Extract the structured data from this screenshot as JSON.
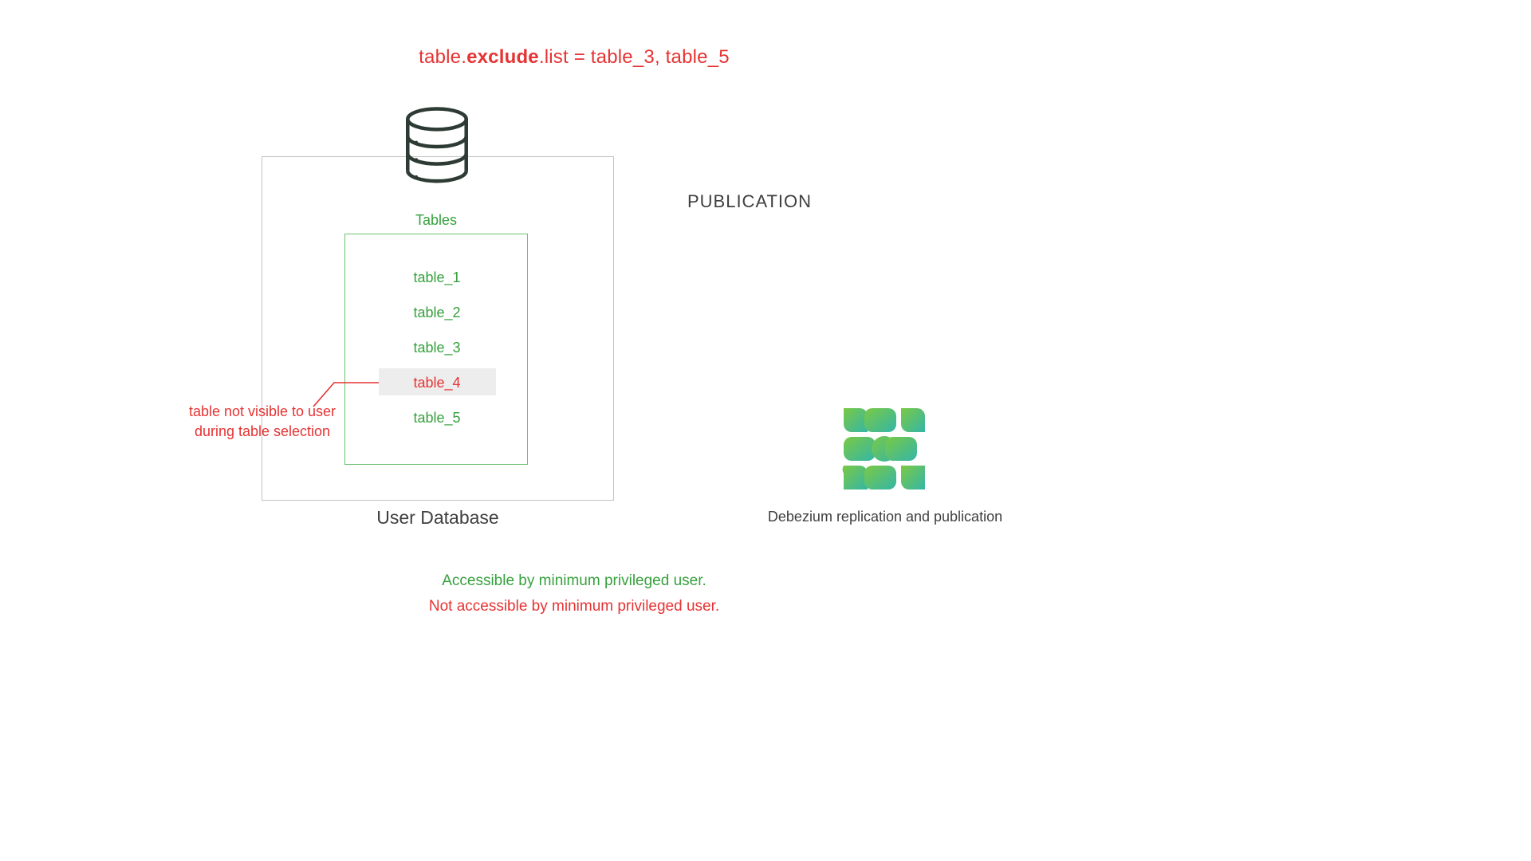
{
  "config": {
    "prefix": "table.",
    "bold": "exclude",
    "suffix": ".list = table_3, table_5"
  },
  "db": {
    "label": "User Database",
    "tables_title": "Tables",
    "tables": [
      {
        "name": "table_1",
        "accessible": true,
        "highlighted": false
      },
      {
        "name": "table_2",
        "accessible": true,
        "highlighted": false
      },
      {
        "name": "table_3",
        "accessible": true,
        "highlighted": false
      },
      {
        "name": "table_4",
        "accessible": false,
        "highlighted": true
      },
      {
        "name": "table_5",
        "accessible": true,
        "highlighted": false
      }
    ]
  },
  "callout": {
    "line1": "table not visible to user",
    "line2": "during table selection"
  },
  "publication": {
    "title": "PUBLICATION"
  },
  "debezium": {
    "label": "Debezium replication and publication"
  },
  "legend": {
    "accessible": "Accessible by minimum privileged user.",
    "not_accessible": "Not accessible by minimum privileged user."
  },
  "colors": {
    "green": "#36a13d",
    "red": "#e63333",
    "border_grey": "#c3c3c3"
  }
}
